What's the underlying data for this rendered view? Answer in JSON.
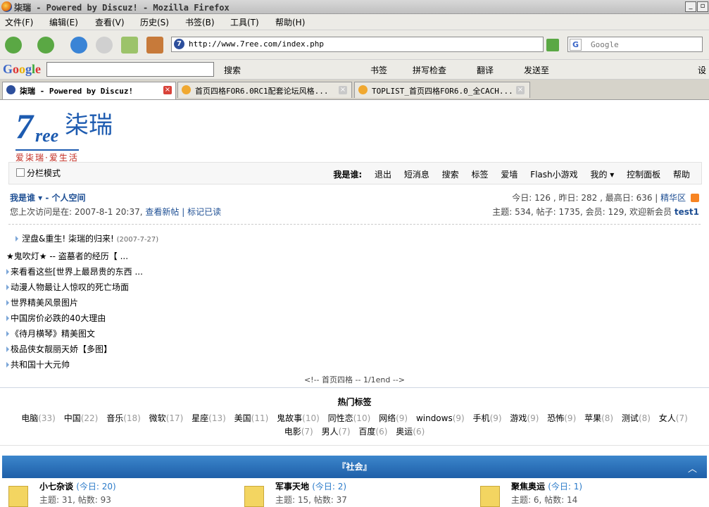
{
  "window": {
    "title": "柒瑞 - Powered by Discuz! - Mozilla Firefox"
  },
  "menu": [
    "文件(F)",
    "编辑(E)",
    "查看(V)",
    "历史(S)",
    "书签(B)",
    "工具(T)",
    "帮助(H)"
  ],
  "nav": {
    "url": "http://www.7ree.com/index.php",
    "search_placeholder": "Google"
  },
  "google_toolbar": {
    "logo": "Google",
    "items": [
      "搜索",
      "书签",
      "拼写检查",
      "翻译",
      "发送至",
      "设"
    ]
  },
  "tabs": [
    {
      "label": "柒瑞 - Powered by Discuz!"
    },
    {
      "label": "首页四格FOR6.0RC1配套论坛风格..."
    },
    {
      "label": "TOPLIST_首页四格FOR6.0_全CACH..."
    }
  ],
  "logo": {
    "text_a": "7",
    "text_b": "ree",
    "text_cn": "柒瑞",
    "slogan": "爱柒瑞·爱生活"
  },
  "userbar": {
    "columns_mode": "分栏模式",
    "who": "我是谁:",
    "links": [
      "退出",
      "短消息",
      "搜索",
      "标签",
      "爱墙",
      "Flash小游戏",
      "我的 ▾",
      "控制面板",
      "帮助"
    ]
  },
  "info": {
    "user_line": "我是谁 ▾ - 个人空间",
    "last_visit": "您上次访问是在: 2007-8-1 20:37,",
    "new_posts": "查看新帖",
    "sep": "|",
    "mark_read": "标记已读",
    "stats_day": "今日: 126 , 昨日: 282 , 最高日: 636 |",
    "digest": "精华区",
    "stats_total": "主题: 534, 帖子: 1735, 会员: 129, 欢迎新会员",
    "newest_member": "test1"
  },
  "announcement": {
    "title": "涅盘&重生!  柒瑞的归来!",
    "date": "(2007-7-27)"
  },
  "threads": [
    "★鬼吹灯★ -- 盗墓者的经历【 ...",
    "来看看这些[世界上最昂贵的东西 ...",
    "动漫人物最让人惊叹的死亡场面",
    "世界精美风景图片",
    "中国房价必跌的40大理由",
    "《待月横琴》精美图文",
    "极品侠女靓丽天娇【多图】",
    "共和国十大元帅"
  ],
  "pager": "<!-- 首页四格 -- 1/1end -->",
  "tags_heading": "热门标签",
  "tags": [
    {
      "name": "电脑",
      "count": "(33)"
    },
    {
      "name": "中国",
      "count": "(22)"
    },
    {
      "name": "音乐",
      "count": "(18)"
    },
    {
      "name": "微软",
      "count": "(17)"
    },
    {
      "name": "星座",
      "count": "(13)"
    },
    {
      "name": "美国",
      "count": "(11)"
    },
    {
      "name": "鬼故事",
      "count": "(10)"
    },
    {
      "name": "同性恋",
      "count": "(10)"
    },
    {
      "name": "网络",
      "count": "(9)"
    },
    {
      "name": "windows",
      "count": "(9)"
    },
    {
      "name": "手机",
      "count": "(9)"
    },
    {
      "name": "游戏",
      "count": "(9)"
    },
    {
      "name": "恐怖",
      "count": "(9)"
    },
    {
      "name": "苹果",
      "count": "(8)"
    },
    {
      "name": "测试",
      "count": "(8)"
    },
    {
      "name": "女人",
      "count": "(7)"
    },
    {
      "name": "电影",
      "count": "(7)"
    },
    {
      "name": "男人",
      "count": "(7)"
    },
    {
      "name": "百度",
      "count": "(6)"
    },
    {
      "name": "奥运",
      "count": "(6)"
    }
  ],
  "category": {
    "title": "『社会』"
  },
  "forums": [
    {
      "name": "小七杂谈",
      "today": "(今日: 20)",
      "stats": "主题: 31, 帖数: 93"
    },
    {
      "name": "军事天地",
      "today": "(今日: 2)",
      "stats": "主题: 15, 帖数: 37"
    },
    {
      "name": "聚焦奥运",
      "today": "(今日: 1)",
      "stats": "主题: 6, 帖数: 14"
    }
  ],
  "colors": {
    "link_blue": "#1d4e93",
    "category_bar": "#2a70bb",
    "logo_blue": "#1d5bb0",
    "logo_red": "#c0281e"
  }
}
